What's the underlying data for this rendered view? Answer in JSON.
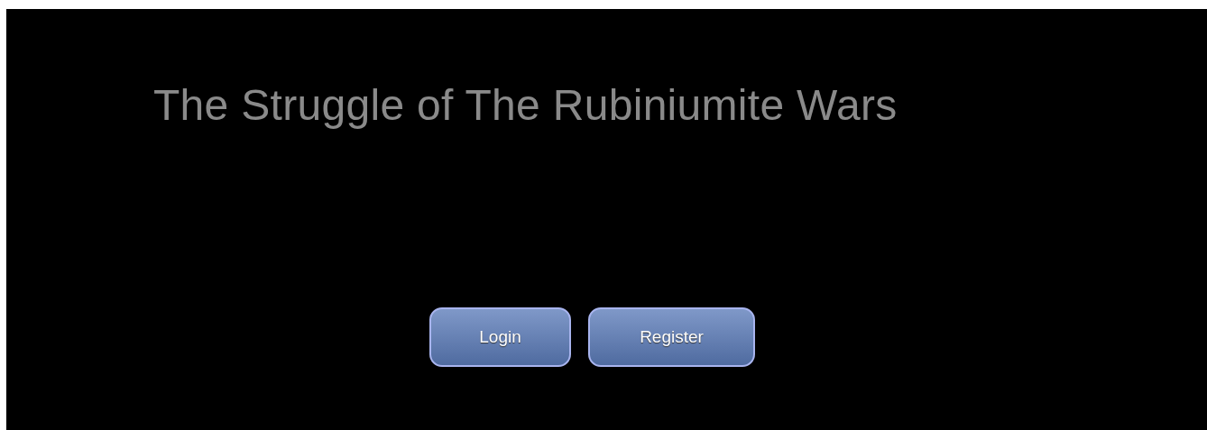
{
  "title": "The Struggle of The Rubiniumite Wars",
  "buttons": [
    {
      "label": "Login"
    },
    {
      "label": "Register"
    }
  ]
}
